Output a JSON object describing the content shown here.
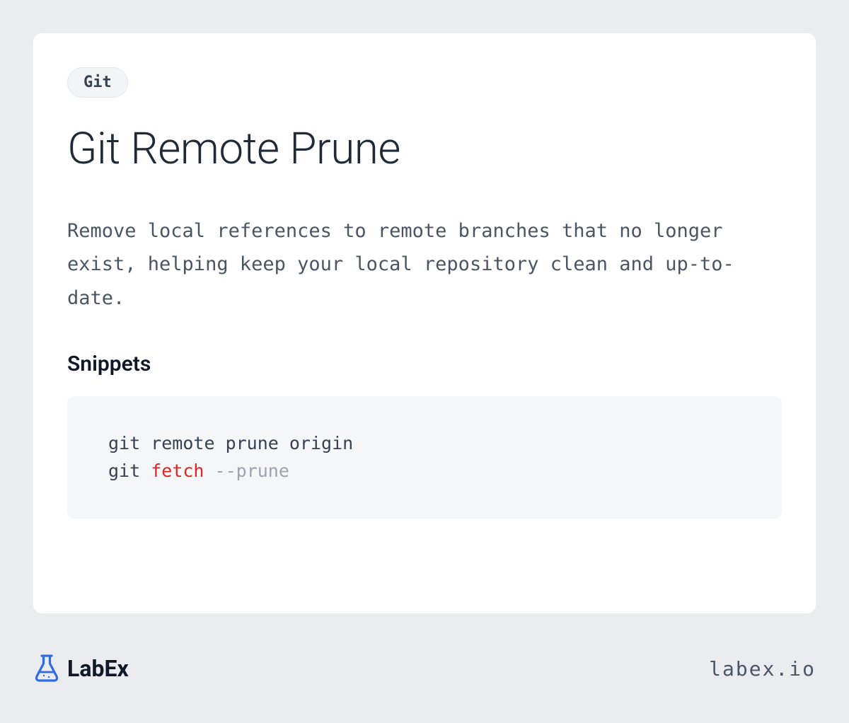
{
  "tag": "Git",
  "title": "Git Remote Prune",
  "description": "Remove local references to remote branches that no longer exist, helping keep your local repository clean and up-to-date.",
  "snippets_heading": "Snippets",
  "code": {
    "line1": "git remote prune origin",
    "line2_prefix": "git ",
    "line2_keyword": "fetch",
    "line2_space": " ",
    "line2_flag": "--prune"
  },
  "logo_text": "LabEx",
  "footer_url": "labex.io"
}
